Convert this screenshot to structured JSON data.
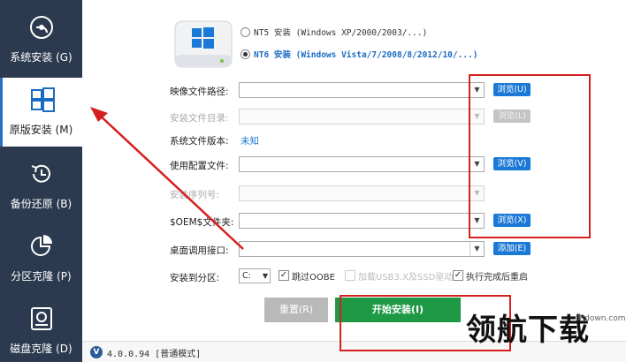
{
  "sidebar": {
    "items": [
      {
        "label": "系统安装 (G)",
        "icon": "system-install-icon"
      },
      {
        "label": "原版安装 (M)",
        "icon": "windows-original-icon"
      },
      {
        "label": "备份还原 (B)",
        "icon": "backup-restore-icon"
      },
      {
        "label": "分区克隆 (P)",
        "icon": "partition-clone-icon"
      },
      {
        "label": "磁盘克隆 (D)",
        "icon": "disk-clone-icon"
      }
    ],
    "active": "原版安装 (M)"
  },
  "mode": {
    "nt5": "NT5 安装 (Windows XP/2000/2003/...)",
    "nt6": "NT6 安装 (Windows Vista/7/2008/8/2012/10/...)",
    "selected": "NT6"
  },
  "form": {
    "image_path_label": "映像文件路径:",
    "browse_u": "浏览(U)",
    "install_dir_label": "安装文件目录:",
    "browse_l": "浏览(L)",
    "version_label": "系统文件版本:",
    "version_value": "未知",
    "config_label": "使用配置文件:",
    "browse_v": "浏览(V)",
    "serial_label": "安装序列号:",
    "oem_label": "$OEM$文件夹:",
    "browse_x": "浏览(X)",
    "desktop_label": "桌面调用接口:",
    "add_e": "添加(E)",
    "partition_label": "安装到分区:",
    "partition_value": "C:",
    "skip_oobe": "跳过OOBE",
    "load_driver": "加载USB3.X及SSD驱动",
    "restart_after": "执行完成后重启"
  },
  "buttons": {
    "reset": "重置(R)",
    "start": "开始安装(I)"
  },
  "status": {
    "text": "4.0.0.94 [普通模式]"
  },
  "watermark": {
    "text": "领航下载",
    "url": "lhdown.com"
  },
  "colors": {
    "sidebar_bg": "#2b3a4f",
    "accent": "#1a78d6",
    "start_green": "#1e9a46",
    "annotation_red": "#d6201f"
  }
}
